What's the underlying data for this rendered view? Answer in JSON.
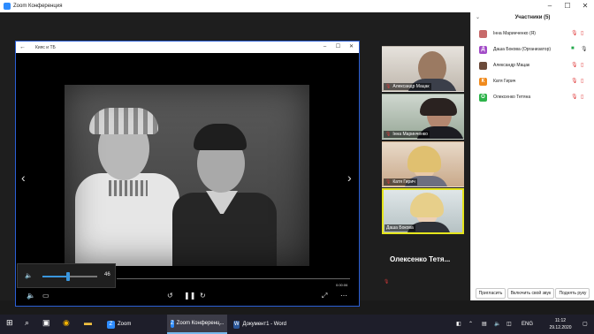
{
  "zoom_window": {
    "title": "Zoom Конференция"
  },
  "viewer": {
    "title": "Кияс и ТБ",
    "volume_value": "46",
    "volume_fraction": 0.46,
    "timecode": "0:00:06"
  },
  "tiles": [
    {
      "name": "Александр Мацак"
    },
    {
      "name": "Інна Маринченко"
    },
    {
      "name": "Катя Гирич"
    },
    {
      "name": "Даша Бокова"
    },
    {
      "name": "Олексенко Тетя..."
    }
  ],
  "panel": {
    "title": "Участники (5)",
    "participants": [
      {
        "name": "Інна Маринченко (Я)",
        "initial": "",
        "color": "#c76a6a",
        "video_icon": "video-off-icon",
        "mic_icon": "mic-off-icon"
      },
      {
        "name": "Даша Бокова (Организатор)",
        "initial": "Д",
        "color": "#a24bc7",
        "video_icon": "video-on-icon",
        "mic_icon": "mic-on-icon"
      },
      {
        "name": "Александр Мацак",
        "initial": "",
        "color": "#6b4a3a",
        "video_icon": "video-off-icon",
        "mic_icon": "mic-off-icon"
      },
      {
        "name": "Катя Гирич",
        "initial": "К",
        "color": "#f08a1c",
        "video_icon": "video-off-icon",
        "mic_icon": "mic-off-icon"
      },
      {
        "name": "Олексенко Тетяна",
        "initial": "О",
        "color": "#2db34a",
        "video_icon": "video-off-icon",
        "mic_icon": "mic-off-icon"
      }
    ],
    "buttons": {
      "invite": "Пригласить",
      "unmute": "Включить свой звук",
      "raise_hand": "Поднять руку"
    }
  },
  "taskbar": {
    "apps": [
      {
        "label": "Zoom",
        "color": "#2d8cff",
        "glyph": "Z"
      },
      {
        "label": "Zoom Конференц...",
        "color": "#2d8cff",
        "glyph": "Z"
      },
      {
        "label": "Документ1 - Word",
        "color": "#2b579a",
        "glyph": "W"
      }
    ],
    "language": "ENG",
    "time": "11:12",
    "date": "29.12.2020"
  },
  "colors": {
    "accent": "#2d8cff",
    "active_speaker": "#e5e51c",
    "muted": "#e03a3a"
  }
}
